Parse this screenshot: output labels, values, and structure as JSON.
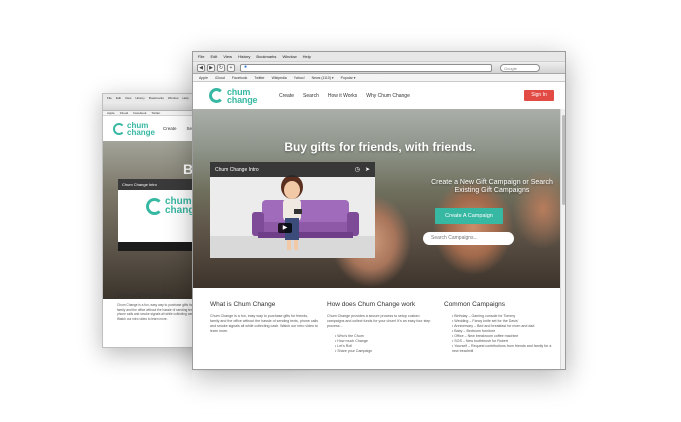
{
  "browser": {
    "menu": [
      "File",
      "Edit",
      "View",
      "History",
      "Bookmarks",
      "Window",
      "Help"
    ],
    "bookmarks": [
      "Apple",
      "iCloud",
      "Facebook",
      "Twitter",
      "Wikipedia",
      "Yahoo!",
      "News (1110) ▾",
      "Popular ▾"
    ],
    "search_placeholder": "Google"
  },
  "site": {
    "logo": {
      "line1": "chum",
      "line2": "change"
    },
    "nav": [
      "Create",
      "Search",
      "How it Works",
      "Why Chum Change"
    ],
    "signin": "Sign In",
    "hero": {
      "title": "Buy gifts for friends, with friends.",
      "subtitle": "Create a New Gift Campaign or Search Existing Gift Campaigns",
      "create_button": "Create A Campaign",
      "search_placeholder": "Search Campaigns..."
    },
    "video": {
      "title": "Chum Change Intro",
      "back_title": "Chum Change Intro"
    },
    "sections": {
      "what": {
        "title": "What is Chum Change",
        "text": "Chum Change is a fun, easy way to purchase gifts for friends, family and the office without the hassle of sending texts, phone calls and smoke signals all while collecting cash. Watch our intro video to learn more."
      },
      "how": {
        "title": "How does Chum Change work",
        "text": "Chum Change provides a secure process to setup custom campaigns and collect funds for your chum! It's an easy four step process...",
        "steps": [
          "Who's the Chum",
          "How much Change",
          "Let's Roll",
          "Share your Campaign"
        ]
      },
      "common": {
        "title": "Common Campaigns",
        "items": [
          "Birthday – Gaming console for Tommy",
          "Wedding – Fancy knife set for the Davis'",
          "Anniversary – Bed and breakfast for mom and dad",
          "Baby – Bedroom furniture",
          "Office – New breakroom coffee machine",
          "SOS – New toothbrush for Robert",
          "Yourself – Request contributions from friends and family for a new treadmill"
        ]
      }
    },
    "back_window": {
      "hero_letter": "B",
      "section_title": "What is Chum Change",
      "section_text": "Chum Change is a fun, easy way to purchase gifts for friends, family and the office without the hassle of sending texts, phone calls and smoke signals all while collecting cash. Watch our intro video to learn more.",
      "nav": [
        "Create",
        "Search"
      ]
    }
  },
  "colors": {
    "brand": "#37b8a3",
    "signin": "#e14b43"
  }
}
